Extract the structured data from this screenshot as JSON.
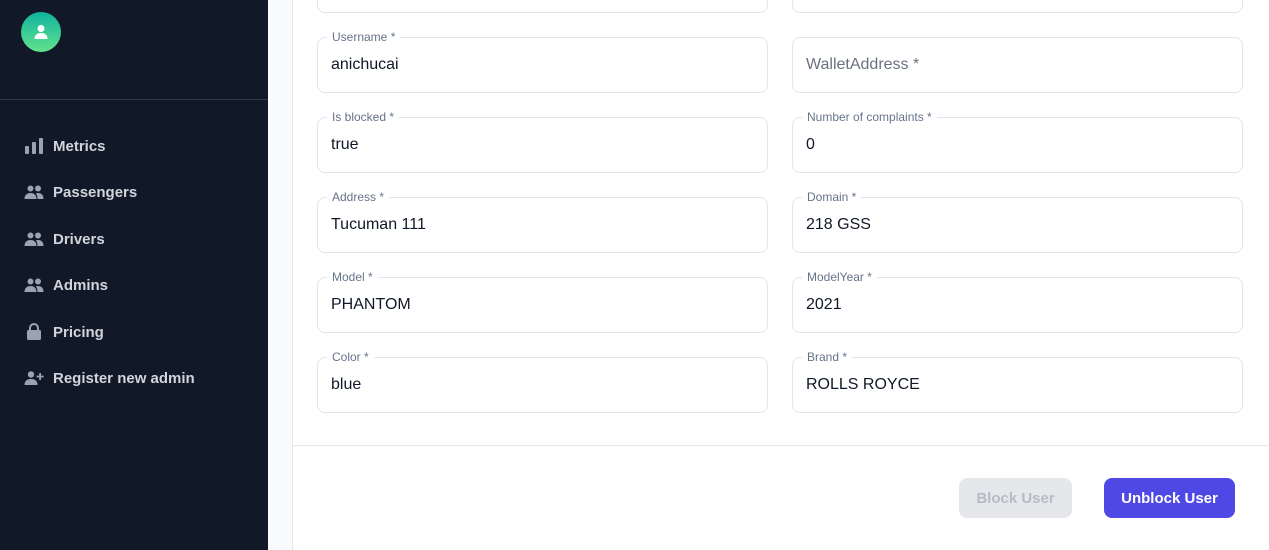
{
  "sidebar": {
    "items": [
      {
        "label": "Metrics",
        "icon": "bar-chart-icon"
      },
      {
        "label": "Passengers",
        "icon": "users-icon"
      },
      {
        "label": "Drivers",
        "icon": "users-icon"
      },
      {
        "label": "Admins",
        "icon": "users-icon"
      },
      {
        "label": "Pricing",
        "icon": "lock-icon"
      },
      {
        "label": "Register new admin",
        "icon": "user-add-icon"
      }
    ]
  },
  "form": {
    "username": {
      "label": "Username *",
      "value": "anichucai"
    },
    "wallet": {
      "label": "WalletAddress *",
      "placeholder": "WalletAddress *"
    },
    "is_blocked": {
      "label": "Is blocked *",
      "value": "true"
    },
    "complaints": {
      "label": "Number of complaints *",
      "value": "0"
    },
    "address": {
      "label": "Address *",
      "value": "Tucuman 111"
    },
    "domain": {
      "label": "Domain *",
      "value": "218 GSS"
    },
    "model": {
      "label": "Model *",
      "value": "PHANTOM"
    },
    "model_year": {
      "label": "ModelYear *",
      "value": "2021"
    },
    "color": {
      "label": "Color *",
      "value": "blue"
    },
    "brand": {
      "label": "Brand *",
      "value": "ROLLS ROYCE"
    }
  },
  "actions": {
    "block_label": "Block User",
    "unblock_label": "Unblock User"
  },
  "colors": {
    "sidebar_bg": "#111827",
    "accent": "#5048e5",
    "avatar_gradient_start": "#10b3a0",
    "avatar_gradient_end": "#62e28b"
  }
}
